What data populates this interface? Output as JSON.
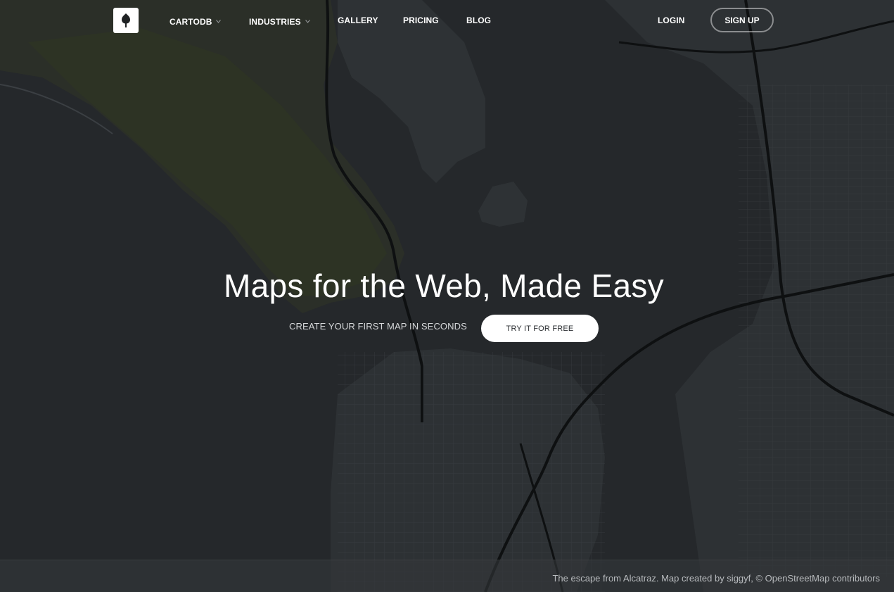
{
  "nav": {
    "logo": "cartodb-logo",
    "items": [
      {
        "label": "CARTODB",
        "has_dropdown": true
      },
      {
        "label": "INDUSTRIES",
        "has_dropdown": true
      },
      {
        "label": "GALLERY",
        "has_dropdown": false
      },
      {
        "label": "PRICING",
        "has_dropdown": false
      },
      {
        "label": "BLOG",
        "has_dropdown": false
      }
    ],
    "login_label": "LOGIN",
    "signup_label": "SIGN UP"
  },
  "hero": {
    "title": "Maps for the Web, Made Easy",
    "subtitle": "CREATE YOUR FIRST MAP IN SECONDS",
    "cta_label": "TRY IT FOR FREE"
  },
  "footer": {
    "credit": "The escape from Alcatraz. Map created by siggyf, © OpenStreetMap contributors"
  },
  "colors": {
    "background": "#25282b",
    "land_green": "#2a2f24",
    "road": "#0f1112",
    "text": "#ffffff"
  }
}
